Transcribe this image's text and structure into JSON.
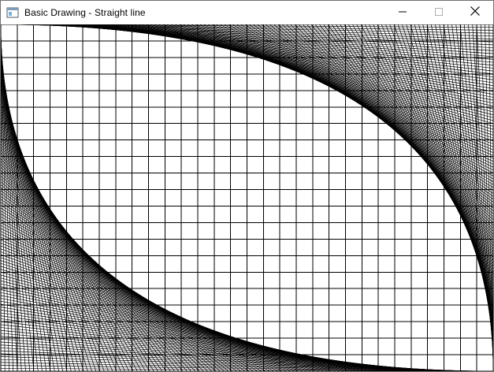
{
  "window": {
    "title": "Basic Drawing - Straight line",
    "icon": "app-window-icon",
    "controls": {
      "minimize_icon": "minimize-icon",
      "maximize_icon": "maximize-icon",
      "close_icon": "close-icon"
    }
  },
  "canvas": {
    "background": "#ffffff",
    "line_color": "#000000",
    "grid_cells": {
      "columns": 30,
      "rows": 21
    },
    "line_envelope_pattern": {
      "families": [
        {
          "name": "top-right",
          "from": "top-edge",
          "to": "right-edge",
          "line_count": 120
        },
        {
          "name": "bottom-left",
          "from": "left-edge",
          "to": "bottom-edge",
          "line_count": 120
        }
      ]
    }
  }
}
